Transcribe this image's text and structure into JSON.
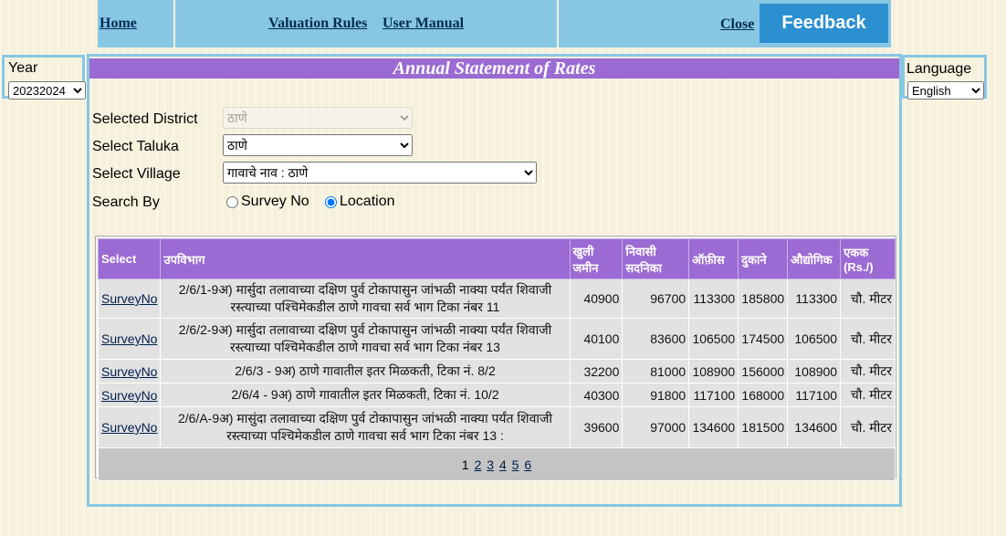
{
  "nav": {
    "home": "Home",
    "valuation_rules": "Valuation Rules",
    "user_manual": "User Manual",
    "close": "Close",
    "feedback": "Feedback"
  },
  "year": {
    "label": "Year",
    "selected": "20232024"
  },
  "language": {
    "label": "Language",
    "selected": "English"
  },
  "title": "Annual Statement of Rates",
  "form": {
    "district_label": "Selected District",
    "district_value": "ठाणे",
    "taluka_label": "Select Taluka",
    "taluka_value": "ठाणे",
    "village_label": "Select Village",
    "village_value": "गावाचे नाव : ठाणे",
    "search_label": "Search By",
    "radio_survey": "Survey No",
    "radio_location": "Location",
    "selected_search": "Location"
  },
  "table": {
    "headers": [
      "Select",
      "उपविभाग",
      "खुली जमीन",
      "निवासी सदनिका",
      "ऑफ़ीस",
      "दुकाने",
      "औद्योगिक",
      "एकक (Rs./)"
    ],
    "rows": [
      {
        "link": "SurveyNo",
        "subdiv": "2/6/1-9अ) मार्सुदा तलावाच्या दक्षिण पुर्व टोकापासुन जांभळी नाक्या पर्यंत शिवाजी रस्त्याच्या पश्चिमेकडील ठाणे गावचा सर्व भाग टिका नंबर 11",
        "open": "40900",
        "res": "96700",
        "office": "113300",
        "shops": "185800",
        "ind": "113300",
        "unit": "चौ. मीटर"
      },
      {
        "link": "SurveyNo",
        "subdiv": "2/6/2-9अ) मार्सुदा तलावाच्या दक्षिण पुर्व टोकापासुन जांभळी नाक्या पर्यंत शिवाजी रस्त्याच्या पश्चिमेकडील ठाणे गावचा सर्व भाग टिका नंबर 13",
        "open": "40100",
        "res": "83600",
        "office": "106500",
        "shops": "174500",
        "ind": "106500",
        "unit": "चौ. मीटर"
      },
      {
        "link": "SurveyNo",
        "subdiv": "2/6/3 - 9अ) ठाणे गावातील इतर मिळकती, टिका नं. 8/2",
        "open": "32200",
        "res": "81000",
        "office": "108900",
        "shops": "156000",
        "ind": "108900",
        "unit": "चौ. मीटर"
      },
      {
        "link": "SurveyNo",
        "subdiv": "2/6/4 - 9अ) ठाणे गावातील इतर मिळकती, टिका नं. 10/2",
        "open": "40300",
        "res": "91800",
        "office": "117100",
        "shops": "168000",
        "ind": "117100",
        "unit": "चौ. मीटर"
      },
      {
        "link": "SurveyNo",
        "subdiv": "2/6/A-9अ) मासुंदा तलावाच्या दक्षिण पुर्व टोकापासुन जांभळी नाक्या पर्यंत शिवाजी रस्त्याच्या पश्चिमेकडील ठाणे गावचा सर्व भाग टिका नंबर 13 :",
        "open": "39600",
        "res": "97000",
        "office": "134600",
        "shops": "181500",
        "ind": "134600",
        "unit": "चौ. मीटर"
      }
    ],
    "pages": [
      "1",
      "2",
      "3",
      "4",
      "5",
      "6"
    ],
    "current_page": "1"
  }
}
